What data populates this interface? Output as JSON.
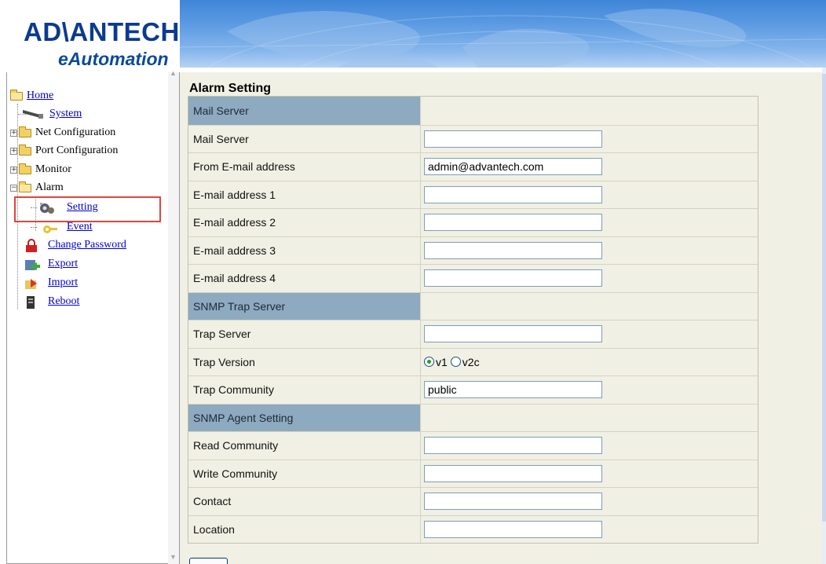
{
  "header": {
    "brand": "AD\\ANTECH",
    "tagline": "eAutomation"
  },
  "nav": {
    "items": [
      {
        "label": "Home",
        "icon": "folder-open-icon",
        "link": true
      },
      {
        "label": "System",
        "icon": "network-cable-icon",
        "link": true
      },
      {
        "label": "Net Configuration",
        "icon": "folder-icon",
        "link": false,
        "expander": "+"
      },
      {
        "label": "Port Configuration",
        "icon": "folder-icon",
        "link": false,
        "expander": "+"
      },
      {
        "label": "Monitor",
        "icon": "folder-icon",
        "link": false,
        "expander": "+"
      },
      {
        "label": "Alarm",
        "icon": "folder-open-icon",
        "link": false,
        "expander": "-"
      },
      {
        "label": "Setting",
        "icon": "settings-icon",
        "link": true,
        "selected": true
      },
      {
        "label": "Event",
        "icon": "key-icon",
        "link": true
      },
      {
        "label": "Change Password",
        "icon": "lock-icon",
        "link": true
      },
      {
        "label": "Export",
        "icon": "export-icon",
        "link": true
      },
      {
        "label": "Import",
        "icon": "import-icon",
        "link": true
      },
      {
        "label": "Reboot",
        "icon": "reboot-icon",
        "link": true
      }
    ]
  },
  "main": {
    "title": "Alarm Setting",
    "rows": [
      {
        "type": "section",
        "label": "Mail Server"
      },
      {
        "type": "text",
        "label": "Mail Server",
        "value": ""
      },
      {
        "type": "text",
        "label": "From E-mail address",
        "value": "admin@advantech.com"
      },
      {
        "type": "text",
        "label": "E-mail address 1",
        "value": ""
      },
      {
        "type": "text",
        "label": "E-mail address 2",
        "value": ""
      },
      {
        "type": "text",
        "label": "E-mail address 3",
        "value": ""
      },
      {
        "type": "text",
        "label": "E-mail address 4",
        "value": ""
      },
      {
        "type": "section",
        "label": "SNMP Trap Server"
      },
      {
        "type": "text",
        "label": "Trap Server",
        "value": ""
      },
      {
        "type": "radio",
        "label": "Trap Version",
        "options": [
          "v1",
          "v2c"
        ],
        "selected": "v1"
      },
      {
        "type": "text",
        "label": "Trap Community",
        "value": "public"
      },
      {
        "type": "section",
        "label": "SNMP Agent Setting"
      },
      {
        "type": "text",
        "label": "Read Community",
        "value": ""
      },
      {
        "type": "text",
        "label": "Write Community",
        "value": ""
      },
      {
        "type": "text",
        "label": "Contact",
        "value": ""
      },
      {
        "type": "text",
        "label": "Location",
        "value": ""
      }
    ]
  },
  "colors": {
    "section_header": "#8eaac0",
    "content_bg": "#f1f0e4",
    "link": "#0000cc",
    "highlight": "#e0453b",
    "brand": "#0b3b8f"
  }
}
